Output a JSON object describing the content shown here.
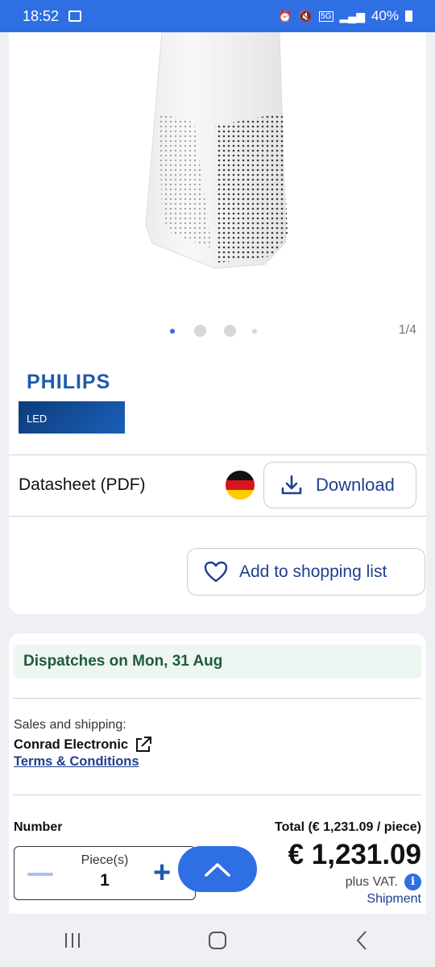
{
  "status_bar": {
    "time": "18:52",
    "battery": "40%",
    "network": "5G"
  },
  "gallery": {
    "page_indicator": "1/4",
    "active_dot_color": "#2f6fe4"
  },
  "brand": {
    "name": "PHILIPS",
    "sub": "LED"
  },
  "datasheet": {
    "label": "Datasheet (PDF)",
    "flag_icon": "germany-flag-icon",
    "download_label": "Download"
  },
  "shopping_list": {
    "label": "Add to shopping list"
  },
  "order": {
    "dispatch": "Dispatches on Mon, 31 Aug",
    "sales_label": "Sales and shipping:",
    "seller": "Conrad Electronic",
    "terms": "Terms & Conditions",
    "number_label": "Number",
    "total_label": "Total (€ 1,231.09 / piece)",
    "unit": "Piece(s)",
    "quantity": "1",
    "price": "€ 1,231.09",
    "vat": "plus VAT.",
    "shipment": "Shipment"
  },
  "colors": {
    "accent": "#2f6fe4",
    "link": "#1f3f8f",
    "dispatch_bg": "#eef6f1",
    "dispatch_text": "#1e5c3d"
  }
}
